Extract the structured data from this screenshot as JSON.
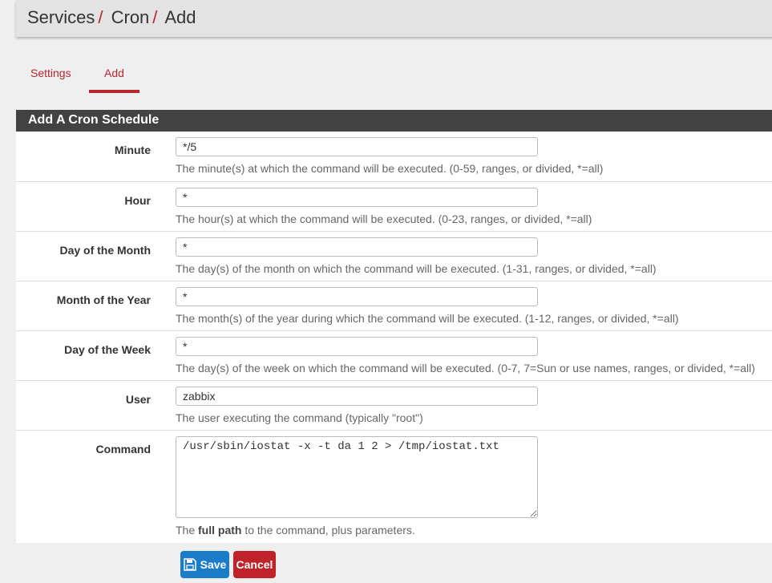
{
  "breadcrumb": {
    "items": [
      "Services",
      "Cron",
      "Add"
    ],
    "separator": "/"
  },
  "tabs": [
    {
      "label": "Settings",
      "active": false
    },
    {
      "label": "Add",
      "active": true
    }
  ],
  "panel": {
    "title": "Add A Cron Schedule"
  },
  "fields": {
    "minute": {
      "label": "Minute",
      "value": "*/5",
      "help": "The minute(s) at which the command will be executed. (0-59, ranges, or divided, *=all)"
    },
    "hour": {
      "label": "Hour",
      "value": "*",
      "help": "The hour(s) at which the command will be executed. (0-23, ranges, or divided, *=all)"
    },
    "mday": {
      "label": "Day of the Month",
      "value": "*",
      "help": "The day(s) of the month on which the command will be executed. (1-31, ranges, or divided, *=all)"
    },
    "month": {
      "label": "Month of the Year",
      "value": "*",
      "help": "The month(s) of the year during which the command will be executed. (1-12, ranges, or divided, *=all)"
    },
    "wday": {
      "label": "Day of the Week",
      "value": "*",
      "help": "The day(s) of the week on which the command will be executed. (0-7, 7=Sun or use names, ranges, or divided, *=all)"
    },
    "user": {
      "label": "User",
      "value": "zabbix",
      "help": "The user executing the command (typically \"root\")"
    },
    "command": {
      "label": "Command",
      "value": "/usr/sbin/iostat -x -t da 1 2 > /tmp/iostat.txt",
      "help_prefix": "The ",
      "help_bold": "full path",
      "help_suffix": " to the command, plus parameters."
    }
  },
  "buttons": {
    "save": "Save",
    "cancel": "Cancel"
  },
  "colors": {
    "accent": "#b5282d",
    "panel_header": "#424242",
    "save_button": "#1b7dc8",
    "cancel_button": "#c0222a"
  },
  "icons": {
    "save": "floppy-disk-icon"
  }
}
